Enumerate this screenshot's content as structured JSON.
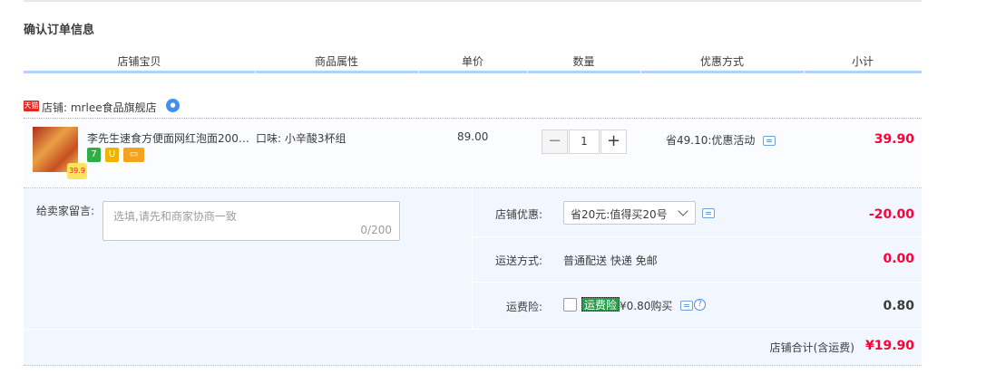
{
  "page": {
    "title": "确认订单信息"
  },
  "table_header": {
    "columns": [
      "店铺宝贝",
      "商品属性",
      "单价",
      "数量",
      "优惠方式",
      "小计"
    ]
  },
  "shop": {
    "platform_badge": "天猫",
    "name": "店铺: mrlee食品旗舰店",
    "chat_icon": "wangwang-chat-icon"
  },
  "item": {
    "thumb_tag": "39.9",
    "title": "李先生速食方便面网红泡面200…",
    "badges": [
      {
        "text": "7",
        "color": "#2fae45"
      },
      {
        "text": "U",
        "color": "#f0b400"
      },
      {
        "text": "▭",
        "color": "#f4a41c"
      }
    ],
    "property": "口味: 小辛酸3杯组",
    "price": "89.00",
    "quantity": "1",
    "minus": "−",
    "plus": "+",
    "discount": "省49.10:优惠活动",
    "subtotal": "39.90"
  },
  "note": {
    "label": "给卖家留言:",
    "placeholder": "选填,请先和商家协商一致",
    "count": "0/200"
  },
  "shop_coupon": {
    "label": "店铺优惠:",
    "selected": "省20元:值得买20号",
    "amount": "-20.00"
  },
  "shipping": {
    "label": "运送方式:",
    "value": "普通配送 快递 免邮",
    "amount": "0.00"
  },
  "insurance": {
    "label": "运费险:",
    "badge": "运费险",
    "text": "¥0.80购买",
    "help": "?",
    "amount": "0.80"
  },
  "total": {
    "label": "店铺合计(含运费)",
    "amount": "¥19.90"
  },
  "colors": {
    "accent_red": "#ff0036",
    "header_bar": "#b2d1ff",
    "panel_bg": "#f2f7ff"
  }
}
